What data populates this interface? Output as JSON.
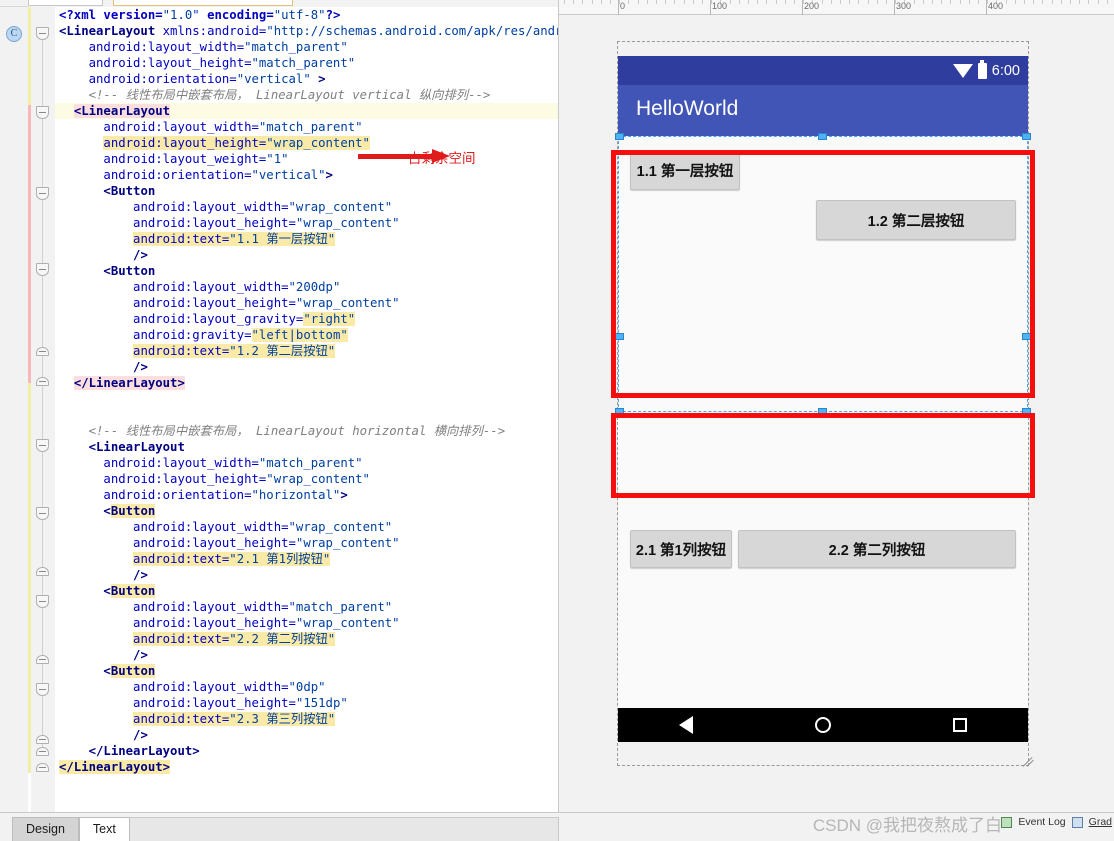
{
  "editor": {
    "gutter_marker": "C",
    "code_lines": [
      {
        "indent": 0,
        "highlight": false,
        "segments": [
          {
            "t": "<?xml version=",
            "c": "pi"
          },
          {
            "t": "\"1.0\"",
            "c": "val"
          },
          {
            "t": " encoding=",
            "c": "pi"
          },
          {
            "t": "\"utf-8\"",
            "c": "val"
          },
          {
            "t": "?>",
            "c": "pi"
          }
        ]
      },
      {
        "indent": 0,
        "highlight": false,
        "segments": [
          {
            "t": "<LinearLayout",
            "c": "tag"
          },
          {
            "t": " xmlns:android=",
            "c": "attr"
          },
          {
            "t": "\"http://schemas.android.com/apk/res/android\"",
            "c": "val"
          }
        ]
      },
      {
        "indent": 4,
        "highlight": false,
        "segments": [
          {
            "t": "android:layout_width=",
            "c": "attr"
          },
          {
            "t": "\"match_parent\"",
            "c": "val"
          }
        ]
      },
      {
        "indent": 4,
        "highlight": false,
        "segments": [
          {
            "t": "android:layout_height=",
            "c": "attr"
          },
          {
            "t": "\"match_parent\"",
            "c": "val"
          }
        ]
      },
      {
        "indent": 4,
        "highlight": false,
        "segments": [
          {
            "t": "android:orientation=",
            "c": "attr"
          },
          {
            "t": "\"vertical\"",
            "c": "val"
          },
          {
            "t": " >",
            "c": "tag"
          }
        ]
      },
      {
        "indent": 4,
        "highlight": false,
        "segments": [
          {
            "t": "<!-- 线性布局中嵌套布局， LinearLayout vertical 纵向排列-->",
            "c": "cmt"
          }
        ]
      },
      {
        "indent": 2,
        "highlight": true,
        "segments": [
          {
            "t": "<LinearLayout",
            "c": "tag hlpink"
          }
        ]
      },
      {
        "indent": 6,
        "highlight": false,
        "segments": [
          {
            "t": "android:layout_width=",
            "c": "attr"
          },
          {
            "t": "\"match_parent\"",
            "c": "val"
          }
        ]
      },
      {
        "indent": 6,
        "highlight": false,
        "segments": [
          {
            "t": "android:layout_height=",
            "c": "attr hlyellow"
          },
          {
            "t": "\"wrap_content\"",
            "c": "val hlyellow"
          }
        ]
      },
      {
        "indent": 6,
        "highlight": false,
        "segments": [
          {
            "t": "android:layout_weight=",
            "c": "attr"
          },
          {
            "t": "\"1\"",
            "c": "val"
          }
        ]
      },
      {
        "indent": 6,
        "highlight": false,
        "segments": [
          {
            "t": "android:orientation=",
            "c": "attr"
          },
          {
            "t": "\"vertical\"",
            "c": "val"
          },
          {
            "t": ">",
            "c": "tag"
          }
        ]
      },
      {
        "indent": 6,
        "highlight": false,
        "segments": [
          {
            "t": "<Button",
            "c": "tag"
          }
        ]
      },
      {
        "indent": 10,
        "highlight": false,
        "segments": [
          {
            "t": "android:layout_width=",
            "c": "attr"
          },
          {
            "t": "\"wrap_content\"",
            "c": "val"
          }
        ]
      },
      {
        "indent": 10,
        "highlight": false,
        "segments": [
          {
            "t": "android:layout_height=",
            "c": "attr"
          },
          {
            "t": "\"wrap_content\"",
            "c": "val"
          }
        ]
      },
      {
        "indent": 10,
        "highlight": false,
        "segments": [
          {
            "t": "android:text=",
            "c": "attr hlyellow"
          },
          {
            "t": "\"1.1 第一层按钮\"",
            "c": "val hlyellow"
          }
        ]
      },
      {
        "indent": 10,
        "highlight": false,
        "segments": [
          {
            "t": "/>",
            "c": "tag"
          }
        ]
      },
      {
        "indent": 6,
        "highlight": false,
        "segments": [
          {
            "t": "<Button",
            "c": "tag"
          }
        ]
      },
      {
        "indent": 10,
        "highlight": false,
        "segments": [
          {
            "t": "android:layout_width=",
            "c": "attr"
          },
          {
            "t": "\"200dp\"",
            "c": "val"
          }
        ]
      },
      {
        "indent": 10,
        "highlight": false,
        "segments": [
          {
            "t": "android:layout_height=",
            "c": "attr"
          },
          {
            "t": "\"wrap_content\"",
            "c": "val"
          }
        ]
      },
      {
        "indent": 10,
        "highlight": false,
        "segments": [
          {
            "t": "android:layout_gravity=",
            "c": "attr"
          },
          {
            "t": "\"right\"",
            "c": "val hlyellow"
          }
        ]
      },
      {
        "indent": 10,
        "highlight": false,
        "segments": [
          {
            "t": "android:gravity=",
            "c": "attr"
          },
          {
            "t": "\"left|bottom\"",
            "c": "val hlyellow"
          }
        ]
      },
      {
        "indent": 10,
        "highlight": false,
        "segments": [
          {
            "t": "android:text=",
            "c": "attr hlyellow"
          },
          {
            "t": "\"1.2 第二层按钮\"",
            "c": "val hlyellow"
          }
        ]
      },
      {
        "indent": 10,
        "highlight": false,
        "segments": [
          {
            "t": "/>",
            "c": "tag"
          }
        ]
      },
      {
        "indent": 2,
        "highlight": false,
        "segments": [
          {
            "t": "</LinearLayout>",
            "c": "tag hlpink"
          }
        ]
      },
      {
        "indent": 0,
        "highlight": false,
        "segments": []
      },
      {
        "indent": 0,
        "highlight": false,
        "segments": []
      },
      {
        "indent": 4,
        "highlight": false,
        "segments": [
          {
            "t": "<!-- 线性布局中嵌套布局， LinearLayout horizontal 横向排列-->",
            "c": "cmt"
          }
        ]
      },
      {
        "indent": 4,
        "highlight": false,
        "segments": [
          {
            "t": "<LinearLayout",
            "c": "tag"
          }
        ]
      },
      {
        "indent": 6,
        "highlight": false,
        "segments": [
          {
            "t": "android:layout_width=",
            "c": "attr"
          },
          {
            "t": "\"match_parent\"",
            "c": "val"
          }
        ]
      },
      {
        "indent": 6,
        "highlight": false,
        "segments": [
          {
            "t": "android:layout_height=",
            "c": "attr"
          },
          {
            "t": "\"wrap_content\"",
            "c": "val"
          }
        ]
      },
      {
        "indent": 6,
        "highlight": false,
        "segments": [
          {
            "t": "android:orientation=",
            "c": "attr"
          },
          {
            "t": "\"horizontal\"",
            "c": "val"
          },
          {
            "t": ">",
            "c": "tag"
          }
        ]
      },
      {
        "indent": 6,
        "highlight": false,
        "segments": [
          {
            "t": "<",
            "c": "tag"
          },
          {
            "t": "Button",
            "c": "tag hlyellow"
          }
        ]
      },
      {
        "indent": 10,
        "highlight": false,
        "segments": [
          {
            "t": "android:layout_width=",
            "c": "attr"
          },
          {
            "t": "\"wrap_content\"",
            "c": "val"
          }
        ]
      },
      {
        "indent": 10,
        "highlight": false,
        "segments": [
          {
            "t": "android:layout_height=",
            "c": "attr"
          },
          {
            "t": "\"wrap_content\"",
            "c": "val"
          }
        ]
      },
      {
        "indent": 10,
        "highlight": false,
        "segments": [
          {
            "t": "android:text=",
            "c": "attr hlyellow"
          },
          {
            "t": "\"2.1 第1列按钮\"",
            "c": "val hlyellow"
          }
        ]
      },
      {
        "indent": 10,
        "highlight": false,
        "segments": [
          {
            "t": "/>",
            "c": "tag"
          }
        ]
      },
      {
        "indent": 6,
        "highlight": false,
        "segments": [
          {
            "t": "<",
            "c": "tag"
          },
          {
            "t": "Button",
            "c": "tag hlyellow"
          }
        ]
      },
      {
        "indent": 10,
        "highlight": false,
        "segments": [
          {
            "t": "android:layout_width=",
            "c": "attr"
          },
          {
            "t": "\"match_parent\"",
            "c": "val"
          }
        ]
      },
      {
        "indent": 10,
        "highlight": false,
        "segments": [
          {
            "t": "android:layout_height=",
            "c": "attr"
          },
          {
            "t": "\"wrap_content\"",
            "c": "val"
          }
        ]
      },
      {
        "indent": 10,
        "highlight": false,
        "segments": [
          {
            "t": "android:text=",
            "c": "attr hlyellow"
          },
          {
            "t": "\"2.2 第二列按钮\"",
            "c": "val hlyellow"
          }
        ]
      },
      {
        "indent": 10,
        "highlight": false,
        "segments": [
          {
            "t": "/>",
            "c": "tag"
          }
        ]
      },
      {
        "indent": 6,
        "highlight": false,
        "segments": [
          {
            "t": "<",
            "c": "tag"
          },
          {
            "t": "Button",
            "c": "tag hlyellow"
          }
        ]
      },
      {
        "indent": 10,
        "highlight": false,
        "segments": [
          {
            "t": "android:layout_width=",
            "c": "attr"
          },
          {
            "t": "\"0dp\"",
            "c": "val"
          }
        ]
      },
      {
        "indent": 10,
        "highlight": false,
        "segments": [
          {
            "t": "android:layout_height=",
            "c": "attr"
          },
          {
            "t": "\"151dp\"",
            "c": "val"
          }
        ]
      },
      {
        "indent": 10,
        "highlight": false,
        "segments": [
          {
            "t": "android:text=",
            "c": "attr hlyellow"
          },
          {
            "t": "\"2.3 第三列按钮\"",
            "c": "val hlyellow"
          }
        ]
      },
      {
        "indent": 10,
        "highlight": false,
        "segments": [
          {
            "t": "/>",
            "c": "tag"
          }
        ]
      },
      {
        "indent": 4,
        "highlight": false,
        "segments": [
          {
            "t": "</LinearLayout>",
            "c": "tag"
          }
        ]
      },
      {
        "indent": 0,
        "highlight": false,
        "segments": [
          {
            "t": "</LinearLayout>",
            "c": "tag hlyellow"
          }
        ]
      }
    ],
    "annotation": {
      "label": "占剩余空间",
      "color": "#e01b1b"
    }
  },
  "design": {
    "ruler": {
      "labels": [
        "0",
        "100",
        "200",
        "300",
        "400"
      ],
      "positions": [
        59,
        151,
        243,
        335,
        427
      ]
    },
    "status_bar": {
      "time": "6:00",
      "wifi_icon": "wifi-icon",
      "battery_icon": "battery-icon"
    },
    "app_bar": {
      "title": "HelloWorld"
    },
    "buttons": [
      {
        "id": "btn-1-1",
        "label": "1.1 第一层按钮"
      },
      {
        "id": "btn-1-2",
        "label": "1.2 第二层按钮"
      },
      {
        "id": "btn-2-1",
        "label": "2.1 第1列按钮"
      },
      {
        "id": "btn-2-2",
        "label": "2.2 第二列按钮"
      }
    ],
    "nav_bar": {
      "back": "triangle-back-icon",
      "home": "circle-home-icon",
      "recents": "square-recents-icon"
    },
    "colors": {
      "status_bar": "#2f3d9e",
      "app_bar": "#4055b5",
      "annotation_red": "#f50e0e",
      "selection_blue": "#4da3f5",
      "button_face": "#d7d7d7"
    }
  },
  "bottom": {
    "tabs": [
      {
        "label": "Design",
        "active": false
      },
      {
        "label": "Text",
        "active": true
      }
    ],
    "watermark": "CSDN @我把夜熬成了白",
    "status_items": [
      {
        "label": "Event Log"
      },
      {
        "label": "Grad"
      }
    ]
  }
}
